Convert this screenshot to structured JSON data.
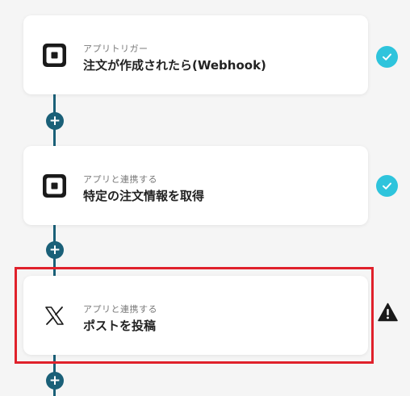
{
  "flow": {
    "steps": [
      {
        "subtitle": "アプリトリガー",
        "title": "注文が作成されたら(Webhook)",
        "app_icon": "square-logo-icon",
        "status": "complete"
      },
      {
        "subtitle": "アプリと連携する",
        "title": "特定の注文情報を取得",
        "app_icon": "square-logo-icon",
        "status": "complete"
      },
      {
        "subtitle": "アプリと連携する",
        "title": "ポストを投稿",
        "app_icon": "x-logo-icon",
        "status": "warning"
      }
    ],
    "add_step_symbol": "+"
  },
  "colors": {
    "connector": "#1a6078",
    "check": "#2ec4dc",
    "highlight": "#e0212b",
    "warning": "#1a1a1a"
  }
}
